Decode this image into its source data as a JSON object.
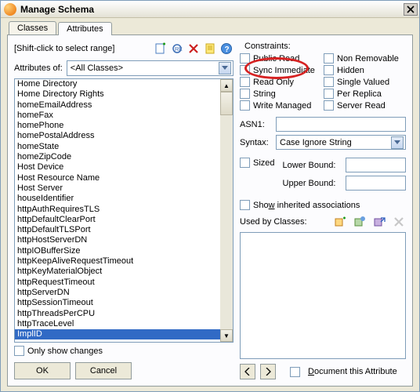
{
  "window": {
    "title": "Manage Schema"
  },
  "tabs": {
    "classes": "Classes",
    "attributes": "Attributes",
    "active": "Attributes"
  },
  "hint": "[Shift-click to select range]",
  "attributesOf": {
    "label": "Attributes of:",
    "value": "<All Classes>"
  },
  "list": [
    "Home Directory",
    "Home Directory Rights",
    "homeEmailAddress",
    "homeFax",
    "homePhone",
    "homePostalAddress",
    "homeState",
    "homeZipCode",
    "Host Device",
    "Host Resource Name",
    "Host Server",
    "houseIdentifier",
    "httpAuthRequiresTLS",
    "httpDefaultClearPort",
    "httpDefaultTLSPort",
    "httpHostServerDN",
    "httpIOBufferSize",
    "httpKeepAliveRequestTimeout",
    "httpKeyMaterialObject",
    "httpRequestTimeout",
    "httpServerDN",
    "httpSessionTimeout",
    "httpThreadsPerCPU",
    "httpTraceLevel",
    "ImplID"
  ],
  "selectedIndex": 24,
  "onlyShowChanges": "Only show changes",
  "buttons": {
    "ok": "OK",
    "cancel": "Cancel"
  },
  "constraints": {
    "label": "Constraints:",
    "col1": [
      "Public Read",
      "Sync Immediate",
      "Read Only",
      "String",
      "Write Managed"
    ],
    "col2": [
      "Non Removable",
      "Hidden",
      "Single Valued",
      "Per Replica",
      "Server Read"
    ]
  },
  "asn1": {
    "label": "ASN1:",
    "value": ""
  },
  "syntax": {
    "label": "Syntax:",
    "value": "Case Ignore String"
  },
  "sized": "Sized",
  "lowerBound": "Lower Bound:",
  "upperBound": "Upper Bound:",
  "showInherited": {
    "pre": "Sho",
    "u": "w",
    "post": " inherited associations"
  },
  "usedBy": "Used by Classes:",
  "documentAttr": "Document this Attribute"
}
